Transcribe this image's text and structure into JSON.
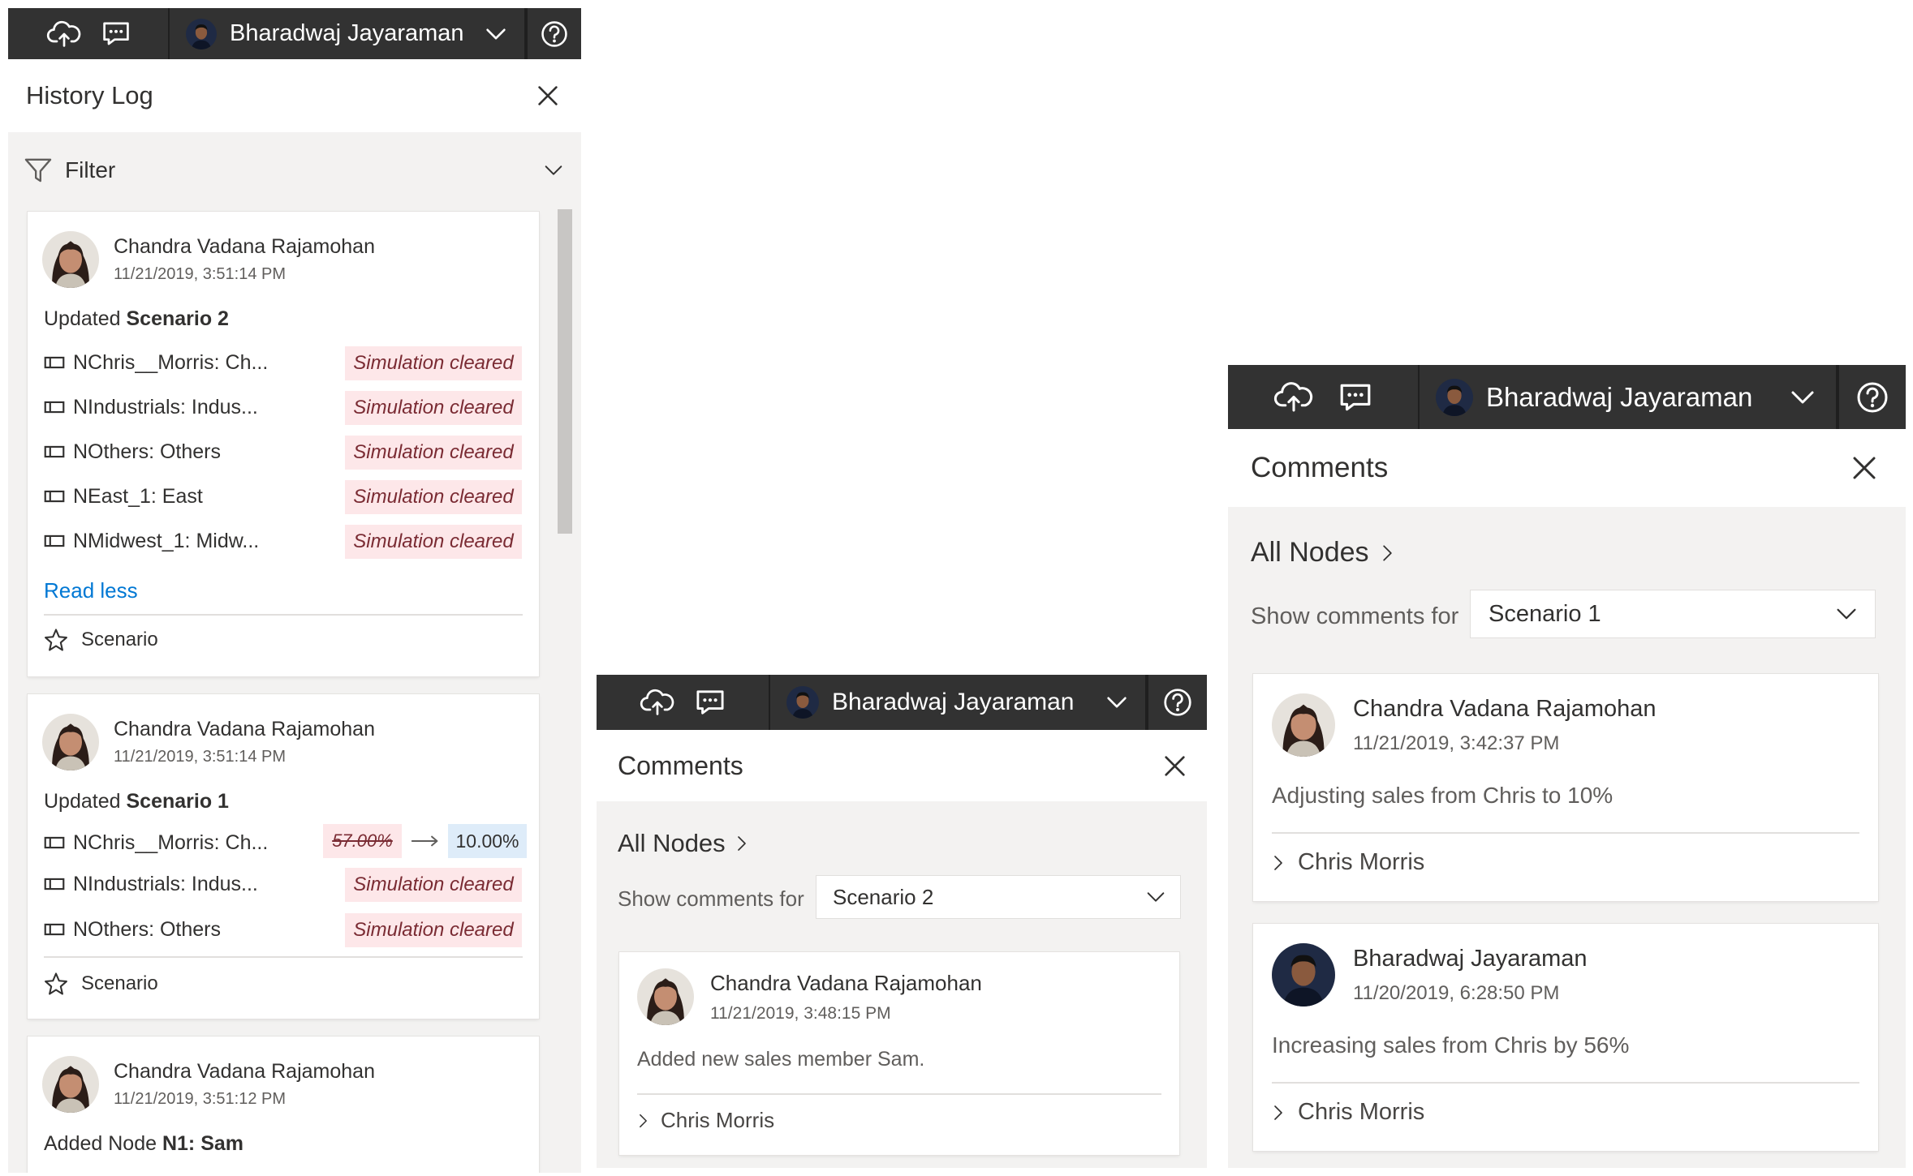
{
  "topbar": {
    "user_name": "Bharadwaj Jayaraman",
    "icons": [
      "upload-cloud-icon",
      "comment-icon",
      "chevron-down-icon",
      "help-icon"
    ]
  },
  "history": {
    "title": "History Log",
    "filter_label": "Filter",
    "entries": [
      {
        "author": "Chandra Vadana Rajamohan",
        "time": "11/21/2019, 3:51:14 PM",
        "action_prefix": "Updated",
        "action_target": "Scenario 2",
        "items": [
          {
            "node": "NChris__Morris: Ch...",
            "status": "Simulation cleared"
          },
          {
            "node": "NIndustrials: Indus...",
            "status": "Simulation cleared"
          },
          {
            "node": "NOthers: Others",
            "status": "Simulation cleared"
          },
          {
            "node": "NEast_1: East",
            "status": "Simulation cleared"
          },
          {
            "node": "NMidwest_1: Midw...",
            "status": "Simulation cleared"
          }
        ],
        "read_less": "Read less",
        "footer": "Scenario"
      },
      {
        "author": "Chandra Vadana Rajamohan",
        "time": "11/21/2019, 3:51:14 PM",
        "action_prefix": "Updated",
        "action_target": "Scenario 1",
        "items": [
          {
            "node": "NChris__Morris: Ch...",
            "old_value": "57.00%",
            "new_value": "10.00%"
          },
          {
            "node": "NIndustrials: Indus...",
            "status": "Simulation cleared"
          },
          {
            "node": "NOthers: Others",
            "status": "Simulation cleared"
          }
        ],
        "footer": "Scenario"
      },
      {
        "author": "Chandra Vadana Rajamohan",
        "time": "11/21/2019, 3:51:12 PM",
        "action_prefix": "Added Node",
        "action_target": "N1: Sam"
      }
    ]
  },
  "comments_small": {
    "title": "Comments",
    "breadcrumb": "All Nodes",
    "show_for_label": "Show comments for",
    "scenario": "Scenario 2",
    "comments": [
      {
        "author": "Chandra Vadana Rajamohan",
        "time": "11/21/2019, 3:48:15 PM",
        "text": "Added new sales member Sam.",
        "node": "Chris Morris"
      }
    ]
  },
  "comments_large": {
    "title": "Comments",
    "breadcrumb": "All Nodes",
    "show_for_label": "Show comments for",
    "scenario": "Scenario 1",
    "comments": [
      {
        "author": "Chandra Vadana Rajamohan",
        "time": "11/21/2019, 3:42:37 PM",
        "text": "Adjusting sales from Chris to 10%",
        "node": "Chris Morris"
      },
      {
        "author": "Bharadwaj Jayaraman",
        "time": "11/20/2019, 6:28:50 PM",
        "text": "Increasing sales from Chris by 56%",
        "node": "Chris Morris"
      }
    ]
  },
  "colors": {
    "topbar": "#323232",
    "panel_gray": "#f3f2f1",
    "badge_red_bg": "#fde7e9",
    "badge_blue_bg": "#deecf9",
    "link": "#0078d4"
  }
}
